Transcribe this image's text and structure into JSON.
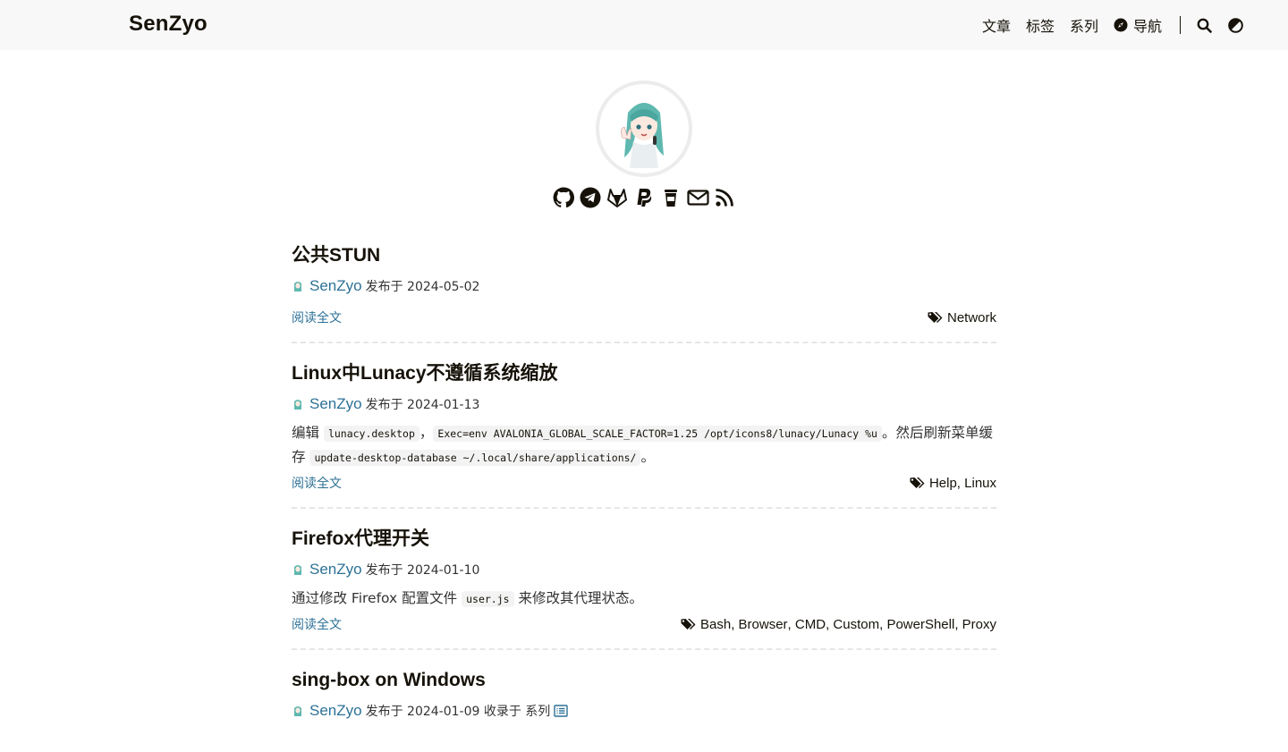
{
  "header": {
    "brand": "SenZyo",
    "menu": {
      "posts": "文章",
      "tags": "标签",
      "series": "系列",
      "nav": "导航"
    }
  },
  "posts": [
    {
      "title": "公共STUN",
      "author": "SenZyo",
      "meta": "发布于 2024-05-02",
      "read_more": "阅读全文",
      "tags": [
        "Network"
      ]
    },
    {
      "title": "Linux中Lunacy不遵循系统缩放",
      "author": "SenZyo",
      "meta": "发布于 2024-01-13",
      "summary": {
        "t1": "编辑 ",
        "c1": "lunacy.desktop",
        "t2": "，",
        "c2": "Exec=env AVALONIA_GLOBAL_SCALE_FACTOR=1.25 /opt/icons8/lunacy/Lunacy %u",
        "t3": "。然后刷新菜单缓存 ",
        "c3": "update-desktop-database ~/.local/share/applications/",
        "t4": "。"
      },
      "read_more": "阅读全文",
      "tags": [
        "Help",
        "Linux"
      ]
    },
    {
      "title": "Firefox代理开关",
      "author": "SenZyo",
      "meta": "发布于 2024-01-10",
      "summary": {
        "t1": "通过修改 Firefox 配置文件 ",
        "c1": "user.js",
        "t2": " 来修改其代理状态。"
      },
      "read_more": "阅读全文",
      "tags": [
        "Bash",
        "Browser",
        "CMD",
        "Custom",
        "PowerShell",
        "Proxy"
      ]
    },
    {
      "title": "sing-box on Windows",
      "author": "SenZyo",
      "meta": "发布于 2024-01-09 收录于 系列"
    }
  ],
  "colors": {
    "accent": "#2d7196",
    "text": "#161209",
    "header_bg": "#f8f8f8"
  },
  "icons": [
    "compass-icon",
    "search-icon",
    "theme-toggle-icon",
    "github-icon",
    "telegram-icon",
    "gitlab-icon",
    "paypal-icon",
    "coffee-icon",
    "email-icon",
    "rss-icon",
    "tags-icon",
    "series-list-icon"
  ]
}
